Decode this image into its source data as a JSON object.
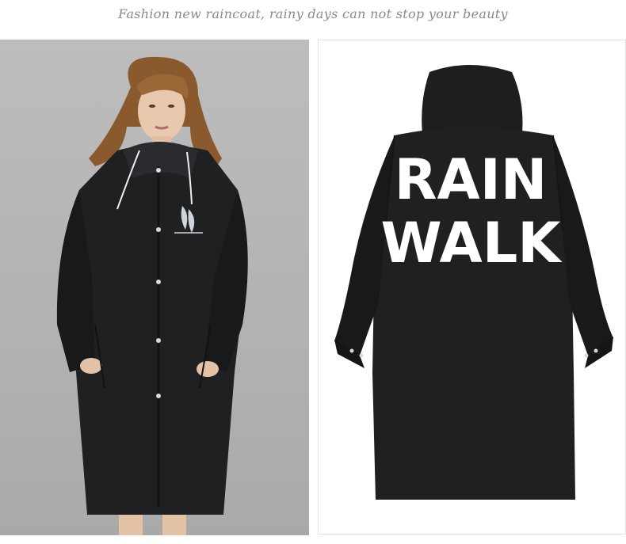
{
  "headline": "Fashion new raincoat, rainy days can not stop your beauty",
  "back_print": {
    "line1": "RAIN",
    "line2": "WALK"
  },
  "colors": {
    "coat": "#1f2022",
    "left_background": "#b5b5b5",
    "headline_text": "#8a8a8a"
  }
}
